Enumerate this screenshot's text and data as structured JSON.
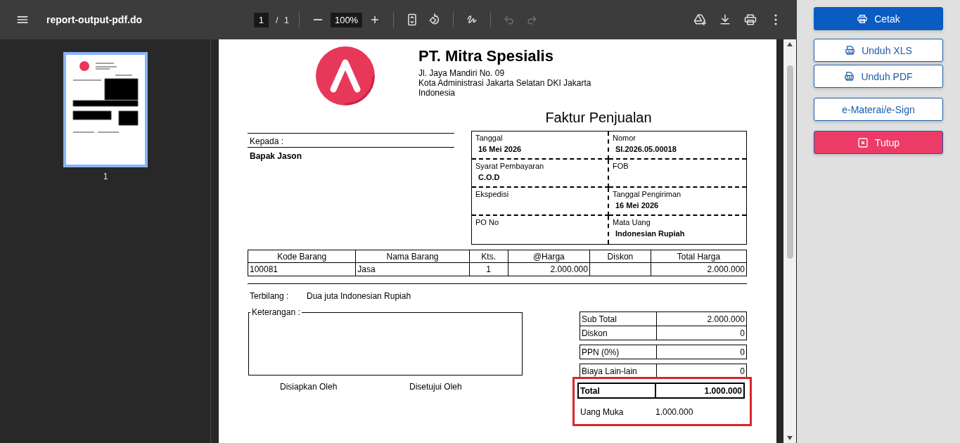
{
  "toolbar": {
    "title": "report-output-pdf.do",
    "page_input": "1",
    "page_separator": "/",
    "page_count": "1",
    "zoom": "100%",
    "undo": {
      "disabled": true
    },
    "redo": {
      "disabled": true
    }
  },
  "thumbnails": [
    {
      "label": "1",
      "selected": true
    }
  ],
  "document": {
    "company": {
      "name": "PT. Mitra Spesialis",
      "address_lines": [
        "Jl. Jaya Mandiri No. 09",
        "Kota Administrasi Jakarta Selatan DKI Jakarta",
        "Indonesia"
      ]
    },
    "title": "Faktur Penjualan",
    "recipient": {
      "label": "Kepada :",
      "name": "Bapak Jason"
    },
    "info": [
      {
        "label": "Tanggal",
        "value": "16 Mei 2026"
      },
      {
        "label": "Nomor",
        "value": "SI.2026.05.00018"
      },
      {
        "label": "Syarat Pembayaran",
        "value": "C.O.D"
      },
      {
        "label": "FOB"
      },
      {
        "label": "Ekspedisi"
      },
      {
        "label": "Tanggal Pengiriman",
        "value": "16 Mei 2026"
      },
      {
        "label": "PO No"
      },
      {
        "label": "Mata Uang",
        "value": "Indonesian Rupiah"
      }
    ],
    "items": {
      "columns": [
        "Kode Barang",
        "Nama Barang",
        "Kts.",
        "@Harga",
        "Diskon",
        "Total Harga"
      ],
      "rows": [
        {
          "code": "100081",
          "name": "Jasa",
          "qty": "1",
          "price": "2.000.000",
          "total": "2.000.000"
        }
      ]
    },
    "terbilang": {
      "label": "Terbilang :",
      "value": "Dua juta Indonesian Rupiah"
    },
    "notes": {
      "label": "Keterangan :"
    },
    "signatures": [
      "Disiapkan Oleh",
      "Disetujui Oleh"
    ],
    "totals": [
      [
        {
          "label": "Sub Total",
          "value": "2.000.000"
        },
        {
          "label": "Diskon",
          "value": "0"
        }
      ],
      [
        {
          "label": "PPN (0%)",
          "value": "0"
        }
      ],
      [
        {
          "label": "Biaya Lain-lain",
          "value": "0"
        }
      ]
    ],
    "summary": {
      "highlighted": true,
      "total": {
        "label": "Total",
        "value": "1.000.000"
      },
      "down_payment": {
        "label": "Uang Muka",
        "value": "1.000.000"
      }
    }
  },
  "actions": [
    {
      "kind": "print",
      "label": "Cetak"
    },
    {
      "kind": "xls",
      "label": "Unduh XLS"
    },
    {
      "kind": "pdf",
      "label": "Unduh PDF"
    },
    {
      "kind": "plain",
      "label": "e-Materai/e-Sign"
    },
    {
      "kind": "close",
      "label": "Tutup"
    }
  ]
}
